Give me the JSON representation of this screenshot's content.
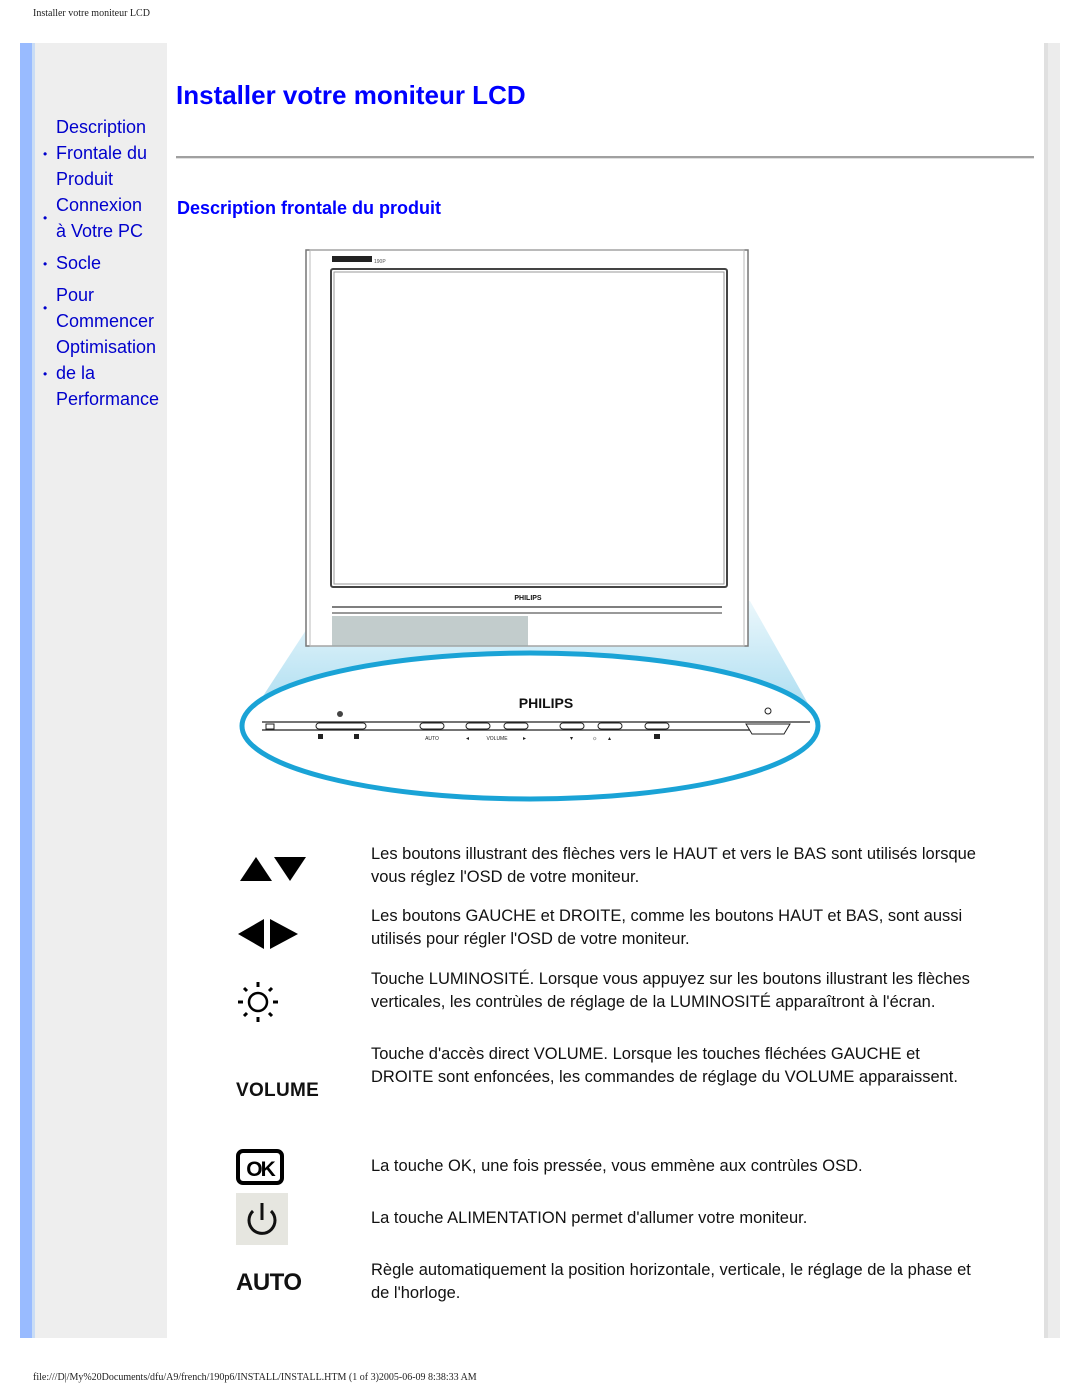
{
  "print_header": "Installer votre moniteur LCD",
  "print_footer": "file:///D|/My%20Documents/dfu/A9/french/190p6/INSTALL/INSTALL.HTM (1 of 3)2005-06-09 8:38:33 AM",
  "colors": {
    "link": "#0000cc",
    "heading": "#0000ff",
    "sidebar_bg": "#eeeeee",
    "accent_bar": "#99bbff",
    "callout_ring": "#1aa3d6"
  },
  "sidebar": {
    "items": [
      {
        "lines": [
          "Description",
          "Frontale du",
          "Produit"
        ],
        "bullet_line": 1
      },
      {
        "lines": [
          "Connexion",
          "à Votre PC"
        ],
        "bullet_line": 0
      },
      {
        "lines": [
          "Socle"
        ],
        "bullet_line": 0
      },
      {
        "lines": [
          "Pour",
          "Commencer"
        ],
        "bullet_line": 0
      },
      {
        "lines": [
          "Optimisation",
          "de la",
          "Performance"
        ],
        "bullet_line": 1
      }
    ]
  },
  "main": {
    "title": "Installer votre moniteur LCD",
    "subtitle": "Description frontale du produit",
    "figure": {
      "brand": "PHILIPS",
      "model_badge": "BRILLIANCE 190P",
      "button_labels": {
        "auto": "AUTO",
        "volume": "VOLUME"
      }
    },
    "descriptions": [
      {
        "icon": "up-down-arrows-icon",
        "text": "Les boutons illustrant des flèches vers le HAUT et vers le BAS sont utilisés lorsque vous réglez l'OSD de votre moniteur."
      },
      {
        "icon": "left-right-arrows-icon",
        "text": "Les boutons GAUCHE et DROITE, comme les boutons HAUT et BAS, sont aussi utilisés pour régler l'OSD de votre moniteur."
      },
      {
        "icon": "brightness-icon",
        "text": "Touche LUMINOSITÉ. Lorsque vous appuyez sur les boutons illustrant les flèches verticales, les contrùles de réglage de la LUMINOSITÉ apparaîtront à l'écran."
      },
      {
        "icon": "volume-label-icon",
        "label": "VOLUME",
        "text": "Touche d'accès direct VOLUME. Lorsque les touches fléchées GAUCHE et DROITE sont enfoncées, les commandes de réglage du VOLUME apparaissent."
      },
      {
        "icon": "ok-icon",
        "label": "OK",
        "text": "La touche OK, une fois pressée, vous emmène aux contrùles OSD."
      },
      {
        "icon": "power-icon",
        "text": "La touche ALIMENTATION permet d'allumer votre moniteur."
      },
      {
        "icon": "auto-label-icon",
        "label": "AUTO",
        "text": "Règle automatiquement la position horizontale, verticale, le réglage de la phase et de l'horloge."
      }
    ]
  }
}
